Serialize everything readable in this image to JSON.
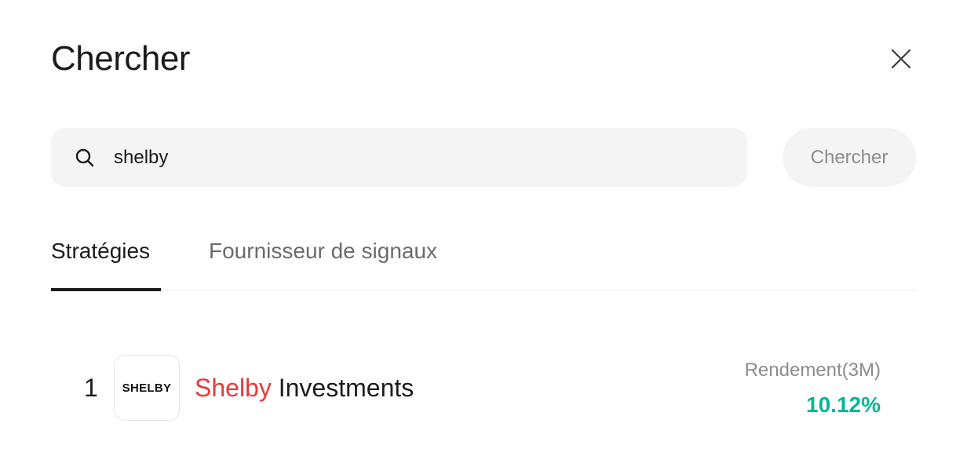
{
  "modal": {
    "title": "Chercher",
    "close_icon": "close-icon"
  },
  "search": {
    "icon": "search-icon",
    "value": "shelby",
    "button_label": "Chercher"
  },
  "tabs": [
    {
      "label": "Stratégies",
      "active": true
    },
    {
      "label": "Fournisseur de signaux",
      "active": false
    }
  ],
  "results": [
    {
      "rank": "1",
      "logo_text": "SHELBY",
      "name_highlight": "Shelby",
      "name_rest": " Investments",
      "metric_label": "Rendement(3M)",
      "metric_value": "10.12%"
    }
  ],
  "colors": {
    "highlight": "#e8393c",
    "positive": "#00b894",
    "field_bg": "#f4f4f4"
  }
}
